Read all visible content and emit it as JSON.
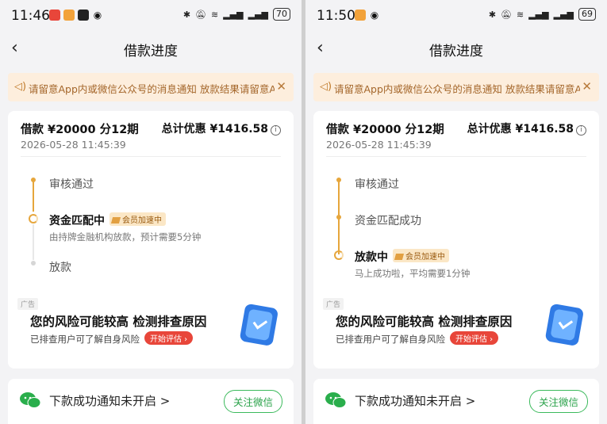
{
  "screens": [
    {
      "status": {
        "time": "11:46",
        "battery": "70"
      },
      "nav": {
        "title": "借款进度"
      },
      "notice": {
        "text": "请留意App内或微信公众号的消息通知      放款结果请留意App内或微信公众号的消息通知"
      },
      "loan": {
        "summary": "借款 ¥20000  分12期",
        "datetime": "2026-05-28 11:45:39",
        "discount": "总计优惠 ¥1416.58"
      },
      "steps": [
        {
          "label": "审核通过"
        },
        {
          "label": "资金匹配中",
          "badge": "会员加速中",
          "sub": "由持牌金融机构放款，预计需要5分钟"
        },
        {
          "label": "放款"
        }
      ],
      "ad": {
        "tag": "广告",
        "title": "您的风险可能较高 检测排查原因",
        "sub": "已排查用户可了解自身风险",
        "button": "开始评估"
      },
      "bottom": {
        "text": "下款成功通知未开启 >",
        "button": "关注微信"
      }
    },
    {
      "status": {
        "time": "11:50",
        "battery": "69"
      },
      "nav": {
        "title": "借款进度"
      },
      "notice": {
        "text": "请留意App内或微信公众号的消息通知      放款结果请留意App内或微信公众号的消息通知"
      },
      "loan": {
        "summary": "借款 ¥20000  分12期",
        "datetime": "2026-05-28 11:45:39",
        "discount": "总计优惠 ¥1416.58"
      },
      "steps": [
        {
          "label": "审核通过"
        },
        {
          "label": "资金匹配成功"
        },
        {
          "label": "放款中",
          "badge": "会员加速中",
          "sub": "马上成功啦，平均需要1分钟"
        }
      ],
      "ad": {
        "tag": "广告",
        "title": "您的风险可能较高 检测排查原因",
        "sub": "已排查用户可了解自身风险",
        "button": "开始评估"
      },
      "bottom": {
        "text": "下款成功通知未开启 >",
        "button": "关注微信"
      }
    }
  ],
  "colors": {
    "accent": "#e6a63c",
    "notice_bg": "#fdeedd",
    "wechat_green": "#3cba5c",
    "ad_button": "#e8463a"
  }
}
